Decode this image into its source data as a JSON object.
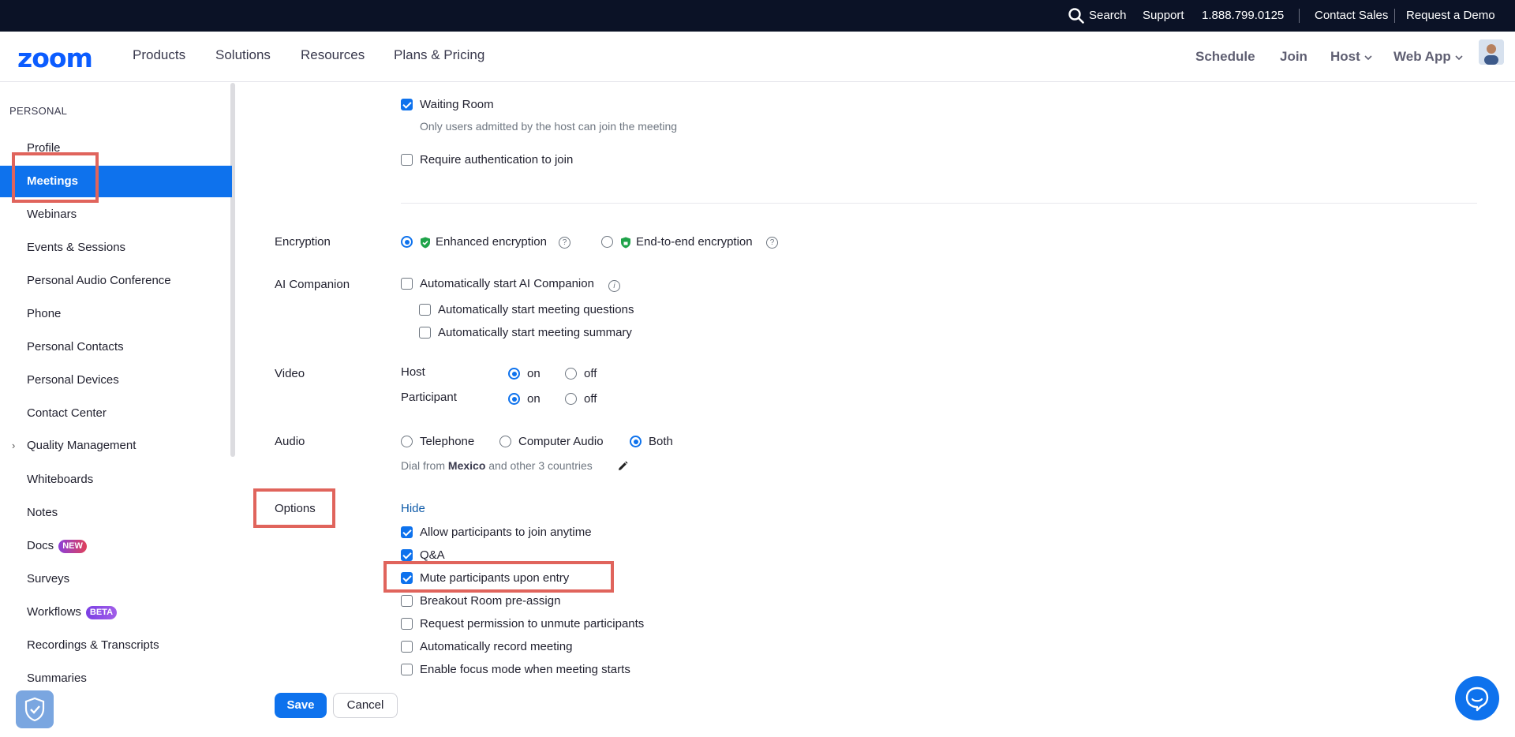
{
  "utilbar": {
    "search_label": "Search",
    "support_label": "Support",
    "phone": "1.888.799.0125",
    "contact_sales": "Contact Sales",
    "request_demo": "Request a Demo"
  },
  "nav": {
    "logo": "zoom",
    "links": [
      "Products",
      "Solutions",
      "Resources",
      "Plans & Pricing"
    ],
    "schedule": "Schedule",
    "join": "Join",
    "host": "Host",
    "web_app": "Web App"
  },
  "sidebar": {
    "heading": "PERSONAL",
    "items": [
      {
        "label": "Profile"
      },
      {
        "label": "Meetings",
        "active": true
      },
      {
        "label": "Webinars"
      },
      {
        "label": "Events & Sessions"
      },
      {
        "label": "Personal Audio Conference"
      },
      {
        "label": "Phone"
      },
      {
        "label": "Personal Contacts"
      },
      {
        "label": "Personal Devices"
      },
      {
        "label": "Contact Center"
      },
      {
        "label": "Quality Management"
      },
      {
        "label": "Whiteboards"
      },
      {
        "label": "Notes"
      },
      {
        "label": "Docs",
        "badge": "NEW"
      },
      {
        "label": "Surveys"
      },
      {
        "label": "Workflows",
        "badge": "BETA"
      },
      {
        "label": "Recordings & Transcripts"
      },
      {
        "label": "Summaries"
      }
    ]
  },
  "security": {
    "waiting_room": {
      "label": "Waiting Room",
      "checked": true,
      "desc": "Only users admitted by the host can join the meeting"
    },
    "require_auth": {
      "label": "Require authentication to join",
      "checked": false
    }
  },
  "encryption": {
    "label": "Encryption",
    "enhanced": {
      "label": "Enhanced encryption",
      "selected": true
    },
    "e2e": {
      "label": "End-to-end encryption",
      "selected": false
    },
    "help_glyph": "?"
  },
  "ai_companion": {
    "label": "AI Companion",
    "auto_start": {
      "label": "Automatically start AI Companion",
      "checked": false
    },
    "questions": {
      "label": "Automatically start meeting questions",
      "checked": false
    },
    "summary": {
      "label": "Automatically start meeting summary",
      "checked": false
    },
    "info_glyph": "i"
  },
  "video": {
    "label": "Video",
    "host_label": "Host",
    "participant_label": "Participant",
    "on": "on",
    "off": "off",
    "host_on": true,
    "participant_on": true
  },
  "audio": {
    "label": "Audio",
    "telephone": "Telephone",
    "computer_audio": "Computer Audio",
    "both": "Both",
    "selected": "Both",
    "dial_from_prefix": "Dial from",
    "dial_from_country": "Mexico",
    "dial_from_suffix": "and other 3 countries"
  },
  "options": {
    "label": "Options",
    "hide_link": "Hide",
    "items": [
      {
        "label": "Allow participants to join anytime",
        "checked": true
      },
      {
        "label": "Q&A",
        "checked": true
      },
      {
        "label": "Mute participants upon entry",
        "checked": true
      },
      {
        "label": "Breakout Room pre-assign",
        "checked": false
      },
      {
        "label": "Request permission to unmute participants",
        "checked": false
      },
      {
        "label": "Automatically record meeting",
        "checked": false
      },
      {
        "label": "Enable focus mode when meeting starts",
        "checked": false
      }
    ]
  },
  "footer": {
    "save": "Save",
    "cancel": "Cancel"
  },
  "colors": {
    "brand_blue": "#0e72ed",
    "utilbar_bg": "#0b1226",
    "highlight_red": "#e0645c"
  }
}
